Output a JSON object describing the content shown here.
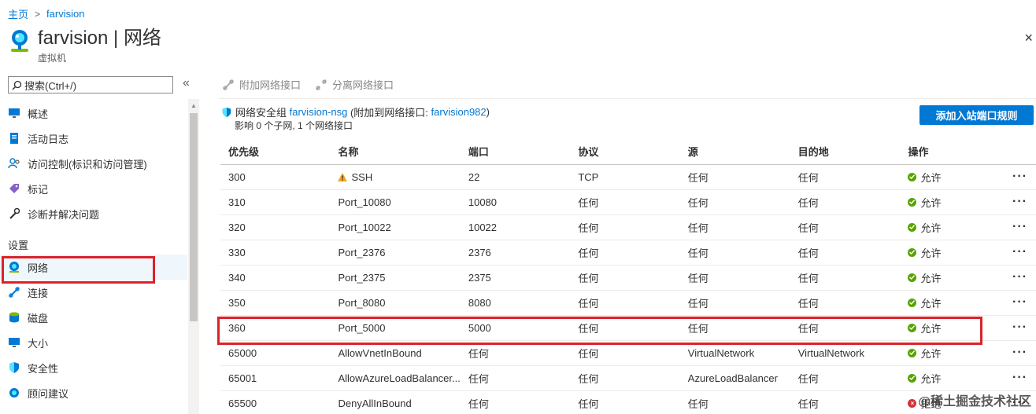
{
  "breadcrumb": {
    "home": "主页",
    "separator": ">",
    "current": "farvision"
  },
  "header": {
    "title": "farvision | 网络",
    "subtitle": "虚拟机",
    "close": "×"
  },
  "search": {
    "placeholder": "搜索(Ctrl+/)",
    "collapse_glyph": "«"
  },
  "sidebar": {
    "items": [
      {
        "label": "概述",
        "icon": "monitor-icon"
      },
      {
        "label": "活动日志",
        "icon": "log-icon"
      },
      {
        "label": "访问控制(标识和访问管理)",
        "icon": "people-icon"
      },
      {
        "label": "标记",
        "icon": "tag-icon"
      },
      {
        "label": "诊断并解决问题",
        "icon": "wrench-icon"
      }
    ],
    "section_settings": "设置",
    "settings_items": [
      {
        "label": "网络",
        "icon": "network-icon",
        "active": true
      },
      {
        "label": "连接",
        "icon": "connect-icon"
      },
      {
        "label": "磁盘",
        "icon": "disk-icon"
      },
      {
        "label": "大小",
        "icon": "size-icon"
      },
      {
        "label": "安全性",
        "icon": "shield-icon"
      },
      {
        "label": "顾问建议",
        "icon": "advisor-icon"
      }
    ]
  },
  "toolbar": {
    "attach": "附加网络接口",
    "detach": "分离网络接口"
  },
  "nsg": {
    "prefix": "网络安全组",
    "nsg_name": "farvision-nsg",
    "attached_prefix": "(附加到网络接口:",
    "nic_name": "farvision982",
    "attached_suffix": ")",
    "impact": "影响 0 个子网, 1 个网络接口",
    "add_inbound": "添加入站端口规则"
  },
  "table": {
    "headers": [
      "优先级",
      "名称",
      "端口",
      "协议",
      "源",
      "目的地",
      "操作"
    ],
    "rows": [
      {
        "priority": "300",
        "name": "SSH",
        "port": "22",
        "protocol": "TCP",
        "source": "任何",
        "destination": "任何",
        "action": "允许",
        "warn": true
      },
      {
        "priority": "310",
        "name": "Port_10080",
        "port": "10080",
        "protocol": "任何",
        "source": "任何",
        "destination": "任何",
        "action": "允许"
      },
      {
        "priority": "320",
        "name": "Port_10022",
        "port": "10022",
        "protocol": "任何",
        "source": "任何",
        "destination": "任何",
        "action": "允许"
      },
      {
        "priority": "330",
        "name": "Port_2376",
        "port": "2376",
        "protocol": "任何",
        "source": "任何",
        "destination": "任何",
        "action": "允许"
      },
      {
        "priority": "340",
        "name": "Port_2375",
        "port": "2375",
        "protocol": "任何",
        "source": "任何",
        "destination": "任何",
        "action": "允许"
      },
      {
        "priority": "350",
        "name": "Port_8080",
        "port": "8080",
        "protocol": "任何",
        "source": "任何",
        "destination": "任何",
        "action": "允许"
      },
      {
        "priority": "360",
        "name": "Port_5000",
        "port": "5000",
        "protocol": "任何",
        "source": "任何",
        "destination": "任何",
        "action": "允许"
      },
      {
        "priority": "65000",
        "name": "AllowVnetInBound",
        "port": "任何",
        "protocol": "任何",
        "source": "VirtualNetwork",
        "destination": "VirtualNetwork",
        "action": "允许"
      },
      {
        "priority": "65001",
        "name": "AllowAzureLoadBalancer...",
        "port": "任何",
        "protocol": "任何",
        "source": "AzureLoadBalancer",
        "destination": "任何",
        "action": "允许"
      },
      {
        "priority": "65500",
        "name": "DenyAllInBound",
        "port": "任何",
        "protocol": "任何",
        "source": "任何",
        "destination": "任何",
        "action": "拒绝",
        "deny": true
      }
    ],
    "more": "···"
  },
  "watermark": "@稀土掘金技术社区",
  "colors": {
    "accent": "#0078d4",
    "allow": "#57a300",
    "deny": "#d13438",
    "highlight": "#d9232b"
  }
}
